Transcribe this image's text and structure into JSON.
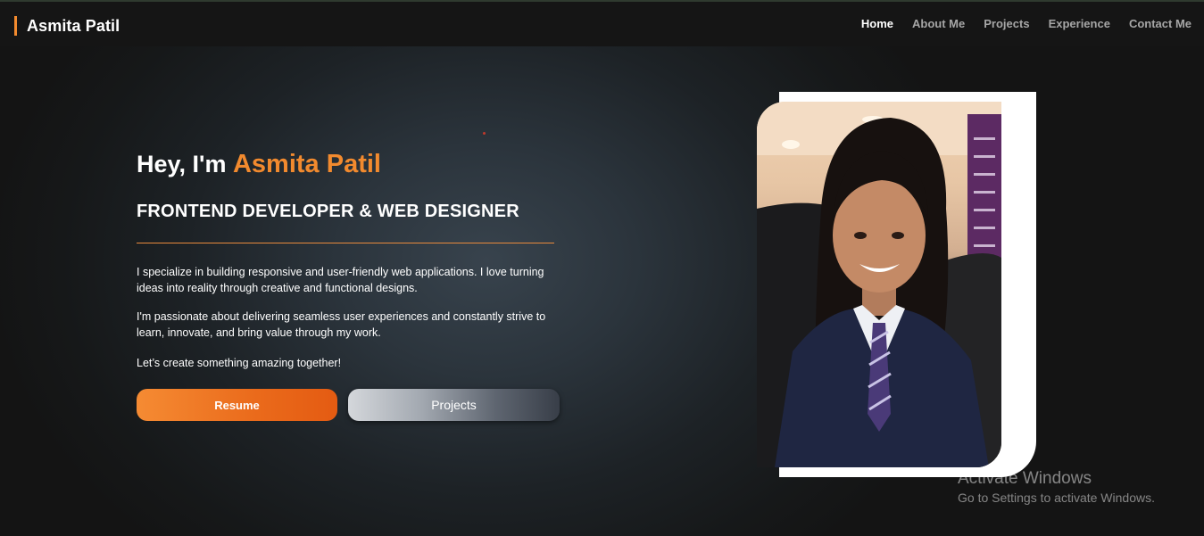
{
  "brand": {
    "name": "Asmita Patil",
    "accent_color": "#f28a2e"
  },
  "nav": {
    "items": [
      {
        "label": "Home",
        "active": true
      },
      {
        "label": "About Me",
        "active": false
      },
      {
        "label": "Projects",
        "active": false
      },
      {
        "label": "Experience",
        "active": false
      },
      {
        "label": "Contact Me",
        "active": false
      }
    ]
  },
  "hero": {
    "greeting_prefix": "Hey, I'm ",
    "name": "Asmita Patil",
    "role": "FRONTEND DEVELOPER & WEB DESIGNER",
    "paragraphs": [
      "I specialize in building responsive and user-friendly web applications. I love turning ideas into reality through creative and functional designs.",
      "I'm passionate about delivering seamless user experiences and constantly strive to learn, innovate, and bring value through my work.",
      "Let’s create something amazing together!"
    ],
    "buttons": {
      "resume": "Resume",
      "projects": "Projects"
    },
    "photo_icon": "profile-photo"
  },
  "watermark": {
    "title": "Activate Windows",
    "subtitle": "Go to Settings to activate Windows."
  }
}
